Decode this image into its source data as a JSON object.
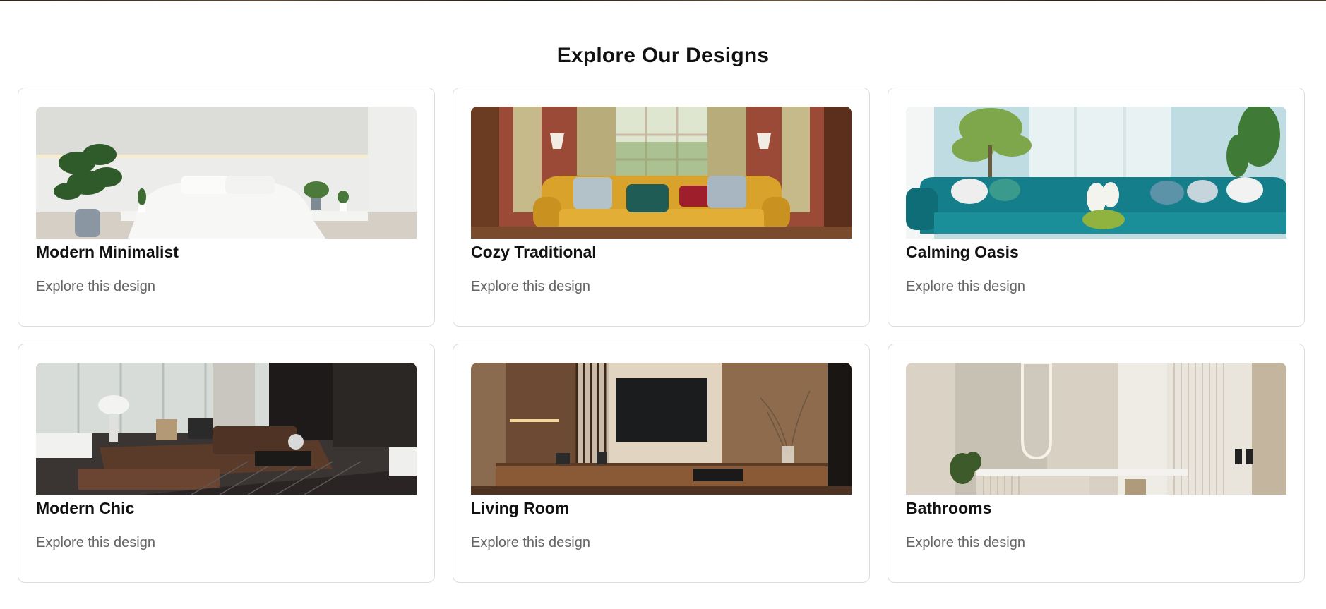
{
  "section": {
    "title": "Explore Our Designs"
  },
  "cards": [
    {
      "title": "Modern Minimalist",
      "link_label": "Explore this design",
      "image": "bedroom-white-photo"
    },
    {
      "title": "Cozy Traditional",
      "link_label": "Explore this design",
      "image": "living-room-yellow-sofa-photo"
    },
    {
      "title": "Calming Oasis",
      "link_label": "Explore this design",
      "image": "teal-sofa-room-photo"
    },
    {
      "title": "Modern Chic",
      "link_label": "Explore this design",
      "image": "brown-leather-sectional-photo"
    },
    {
      "title": "Living Room",
      "link_label": "Explore this design",
      "image": "tv-wall-wood-panel-photo"
    },
    {
      "title": "Bathrooms",
      "link_label": "Explore this design",
      "image": "beige-bathroom-mirror-photo"
    }
  ]
}
